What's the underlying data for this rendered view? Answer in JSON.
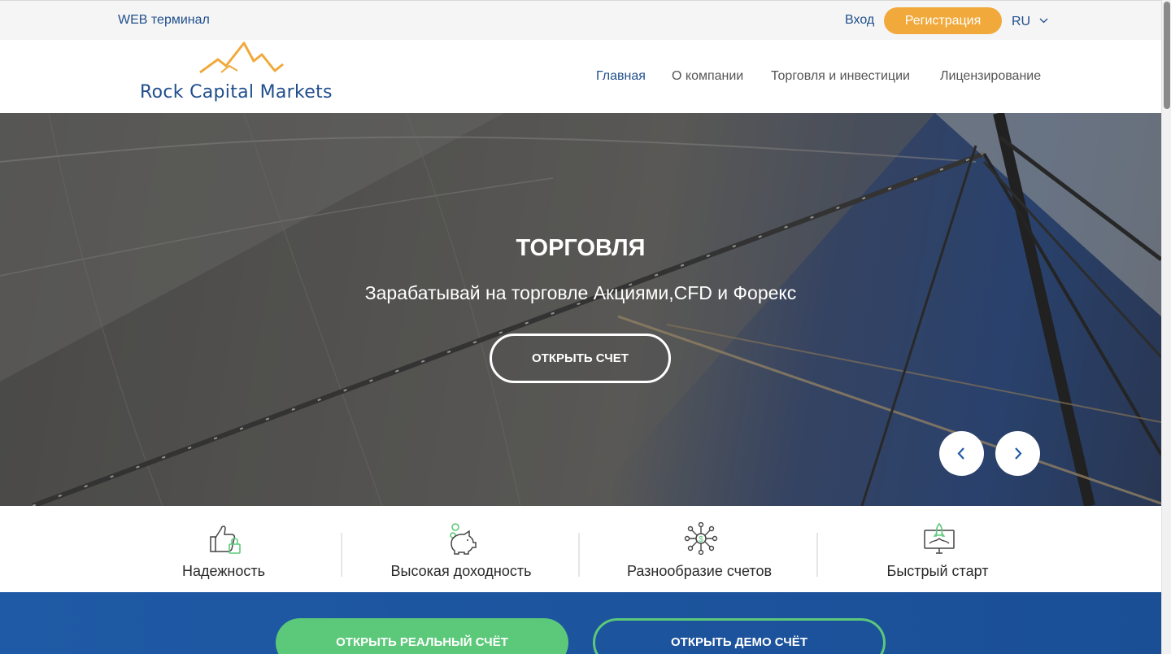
{
  "topbar": {
    "web_terminal": "WEB терминал",
    "login": "Вход",
    "register": "Регистрация",
    "language": "RU"
  },
  "header": {
    "logo_text": "Rock Capital Markets",
    "nav": [
      {
        "label": "Главная",
        "active": true
      },
      {
        "label": "О компании",
        "active": false
      },
      {
        "label": "Торговля и инвестиции",
        "active": false
      },
      {
        "label": "Лицензирование",
        "active": false
      }
    ]
  },
  "hero": {
    "title": "ТОРГОВЛЯ",
    "subtitle": "Зарабатывай на торговле Акциями,CFD и Форекс",
    "cta": "ОТКРЫТЬ СЧЕТ"
  },
  "features": [
    {
      "label": "Надежность",
      "icon": "thumbs-up-lock-icon"
    },
    {
      "label": "Высокая доходность",
      "icon": "piggy-bank-icon"
    },
    {
      "label": "Разнообразие счетов",
      "icon": "network-dollar-icon"
    },
    {
      "label": "Быстрый старт",
      "icon": "rocket-monitor-icon"
    }
  ],
  "band": {
    "real_account": "ОТКРЫТЬ РЕАЛЬНЫЙ СЧЁТ",
    "demo_account": "ОТКРЫТЬ ДЕМО СЧЁТ"
  },
  "colors": {
    "brand_blue": "#1f4e8c",
    "accent_orange": "#f0a93a",
    "accent_green": "#5cc97a",
    "band_blue": "#1f5aa6"
  }
}
